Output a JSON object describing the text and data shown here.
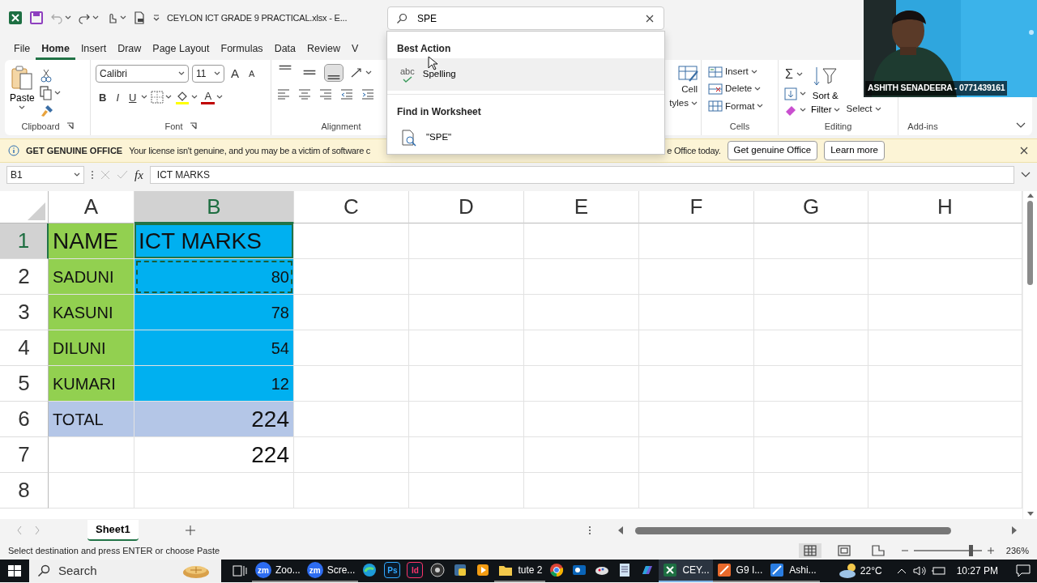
{
  "title_bar": {
    "file_title": "CEYLON ICT GRADE 9 PRACTICAL.xlsx  -  E...",
    "search": {
      "value": "SPE"
    }
  },
  "menu_tabs": [
    {
      "label": "File",
      "selected": false
    },
    {
      "label": "Home",
      "selected": true
    },
    {
      "label": "Insert",
      "selected": false
    },
    {
      "label": "Draw",
      "selected": false
    },
    {
      "label": "Page Layout",
      "selected": false
    },
    {
      "label": "Formulas",
      "selected": false
    },
    {
      "label": "Data",
      "selected": false
    },
    {
      "label": "Review",
      "selected": false
    },
    {
      "label": "V",
      "selected": false
    }
  ],
  "ribbon": {
    "clipboard": {
      "label": "Clipboard",
      "paste": "Paste"
    },
    "font": {
      "label": "Font",
      "font_name": "Calibri",
      "font_size": "11",
      "grow": "A",
      "shrink": "A",
      "bold": "B",
      "italic": "I",
      "underline": "U",
      "font_color": "A"
    },
    "alignment": {
      "label": "Alignment",
      "vertical": [
        {
          "kind": "top",
          "selected": false
        },
        {
          "kind": "middle",
          "selected": false
        },
        {
          "kind": "bottom",
          "selected": true
        }
      ]
    },
    "styles": {
      "line1": "Cell",
      "line2": "tyles"
    },
    "cells": {
      "label": "Cells",
      "buttons": [
        {
          "kind": "insert",
          "label": "Insert"
        },
        {
          "kind": "delete",
          "label": "Delete"
        },
        {
          "kind": "format",
          "label": "Format"
        }
      ]
    },
    "editing": {
      "label": "Editing",
      "autosum": "Σ",
      "sort_line1": "Sort &",
      "sort_line2": "Filter",
      "select": "Select"
    },
    "addins": {
      "label": "Add-ins"
    }
  },
  "search_results": [
    {
      "heading": "Best Action",
      "items": [
        {
          "kind": "spelling",
          "icon_text": "abc",
          "label": "Spelling",
          "hovered": true
        }
      ]
    },
    {
      "heading": "Find in Worksheet",
      "items": [
        {
          "kind": "find",
          "label": "\"SPE\"",
          "hovered": false
        }
      ]
    }
  ],
  "notification": {
    "title": "GET GENUINE OFFICE",
    "message_start": "Your license isn't genuine, and you may be a victim of software c",
    "message_end": "e Office today.",
    "buttons": [
      "Get genuine Office",
      "Learn more"
    ]
  },
  "formula_bar": {
    "name_box": "B1",
    "fx": "fx",
    "formula": "ICT MARKS"
  },
  "sheet": {
    "columns": [
      {
        "label": "A",
        "selected": false
      },
      {
        "label": "B",
        "selected": true
      },
      {
        "label": "C",
        "selected": false
      },
      {
        "label": "D",
        "selected": false
      },
      {
        "label": "E",
        "selected": false
      },
      {
        "label": "F",
        "selected": false
      },
      {
        "label": "G",
        "selected": false
      },
      {
        "label": "H",
        "selected": false
      }
    ],
    "rows": [
      {
        "label": "1",
        "selected": true,
        "cells": [
          {
            "kind": "heading",
            "text": "NAME",
            "color": "#92d050",
            "selected": false,
            "marquee": false
          },
          {
            "kind": "heading",
            "text": "ICT MARKS",
            "color": "#00b0f0",
            "selected": true,
            "marquee": false
          }
        ]
      },
      {
        "label": "2",
        "selected": false,
        "cells": [
          {
            "kind": "label",
            "text": "SADUNI",
            "color": "#92d050",
            "selected": false,
            "marquee": false
          },
          {
            "kind": "number",
            "text": "80",
            "color": "#00b0f0",
            "selected": false,
            "marquee": true
          }
        ]
      },
      {
        "label": "3",
        "selected": false,
        "cells": [
          {
            "kind": "label",
            "text": "KASUNI",
            "color": "#92d050",
            "selected": false,
            "marquee": false
          },
          {
            "kind": "number",
            "text": "78",
            "color": "#00b0f0",
            "selected": false,
            "marquee": false
          }
        ]
      },
      {
        "label": "4",
        "selected": false,
        "cells": [
          {
            "kind": "label",
            "text": "DILUNI",
            "color": "#92d050",
            "selected": false,
            "marquee": false
          },
          {
            "kind": "number",
            "text": "54",
            "color": "#00b0f0",
            "selected": false,
            "marquee": false
          }
        ]
      },
      {
        "label": "5",
        "selected": false,
        "cells": [
          {
            "kind": "label",
            "text": "KUMARI",
            "color": "#92d050",
            "selected": false,
            "marquee": false
          },
          {
            "kind": "number",
            "text": "12",
            "color": "#00b0f0",
            "selected": false,
            "marquee": false
          }
        ]
      },
      {
        "label": "6",
        "selected": false,
        "cells": [
          {
            "kind": "label",
            "text": "TOTAL",
            "color": "#b4c6e7",
            "selected": false,
            "marquee": false
          },
          {
            "kind": "total",
            "text": "224",
            "color": "#b4c6e7",
            "selected": false,
            "marquee": false
          }
        ]
      },
      {
        "label": "7",
        "selected": false,
        "cells": [
          {
            "kind": "blank",
            "selected": false,
            "marquee": false
          },
          {
            "kind": "total",
            "text": "224",
            "selected": false,
            "marquee": false
          }
        ]
      },
      {
        "label": "8",
        "selected": false,
        "cells": [
          {
            "kind": "blank",
            "selected": false,
            "marquee": false
          },
          {
            "kind": "blank",
            "selected": false,
            "marquee": false
          }
        ]
      }
    ]
  },
  "video": {
    "kind": "picture",
    "name_label": "ASHITH SENADEERA - 0771439161"
  },
  "sheet_tabs": [
    {
      "label": "Sheet1",
      "selected": true
    }
  ],
  "status_bar": {
    "message": "Select destination and press ENTER or choose Paste",
    "views": [
      {
        "kind": "normal",
        "selected": true
      },
      {
        "kind": "page_layout",
        "selected": false
      },
      {
        "kind": "page_break",
        "selected": false
      }
    ],
    "zoom": {
      "level": 0.84,
      "reading": "236%"
    }
  },
  "taskbar": {
    "search_placeholder": "Search",
    "apps": [
      {
        "kind": "zoom",
        "badge": "zm",
        "label": "Zoo...",
        "selected": false
      },
      {
        "kind": "zoom",
        "badge": "zm",
        "label": "Scre...",
        "selected": false
      },
      {
        "kind": "edge",
        "selected": false
      },
      {
        "kind": "tile",
        "badge": "Ps",
        "color": "#31a8ff",
        "selected": false
      },
      {
        "kind": "tile",
        "badge": "Id",
        "color": "#ff3366",
        "selected": false
      },
      {
        "kind": "obs",
        "selected": false
      },
      {
        "kind": "python",
        "selected": false
      },
      {
        "kind": "media",
        "selected": false
      },
      {
        "kind": "folder",
        "label": "tute 2",
        "selected": false
      },
      {
        "kind": "chrome",
        "selected": false
      },
      {
        "kind": "outlook",
        "selected": false
      },
      {
        "kind": "paint",
        "selected": false
      },
      {
        "kind": "notepad",
        "selected": false
      },
      {
        "kind": "copilot",
        "selected": false
      },
      {
        "kind": "excel",
        "label": "CEY...",
        "selected": true
      },
      {
        "kind": "pencil_orange",
        "label": "G9 I...",
        "selected": false
      },
      {
        "kind": "pencil_blue",
        "label": "Ashi...",
        "selected": false
      }
    ],
    "weather": "22°C",
    "time": "10:27 PM"
  }
}
